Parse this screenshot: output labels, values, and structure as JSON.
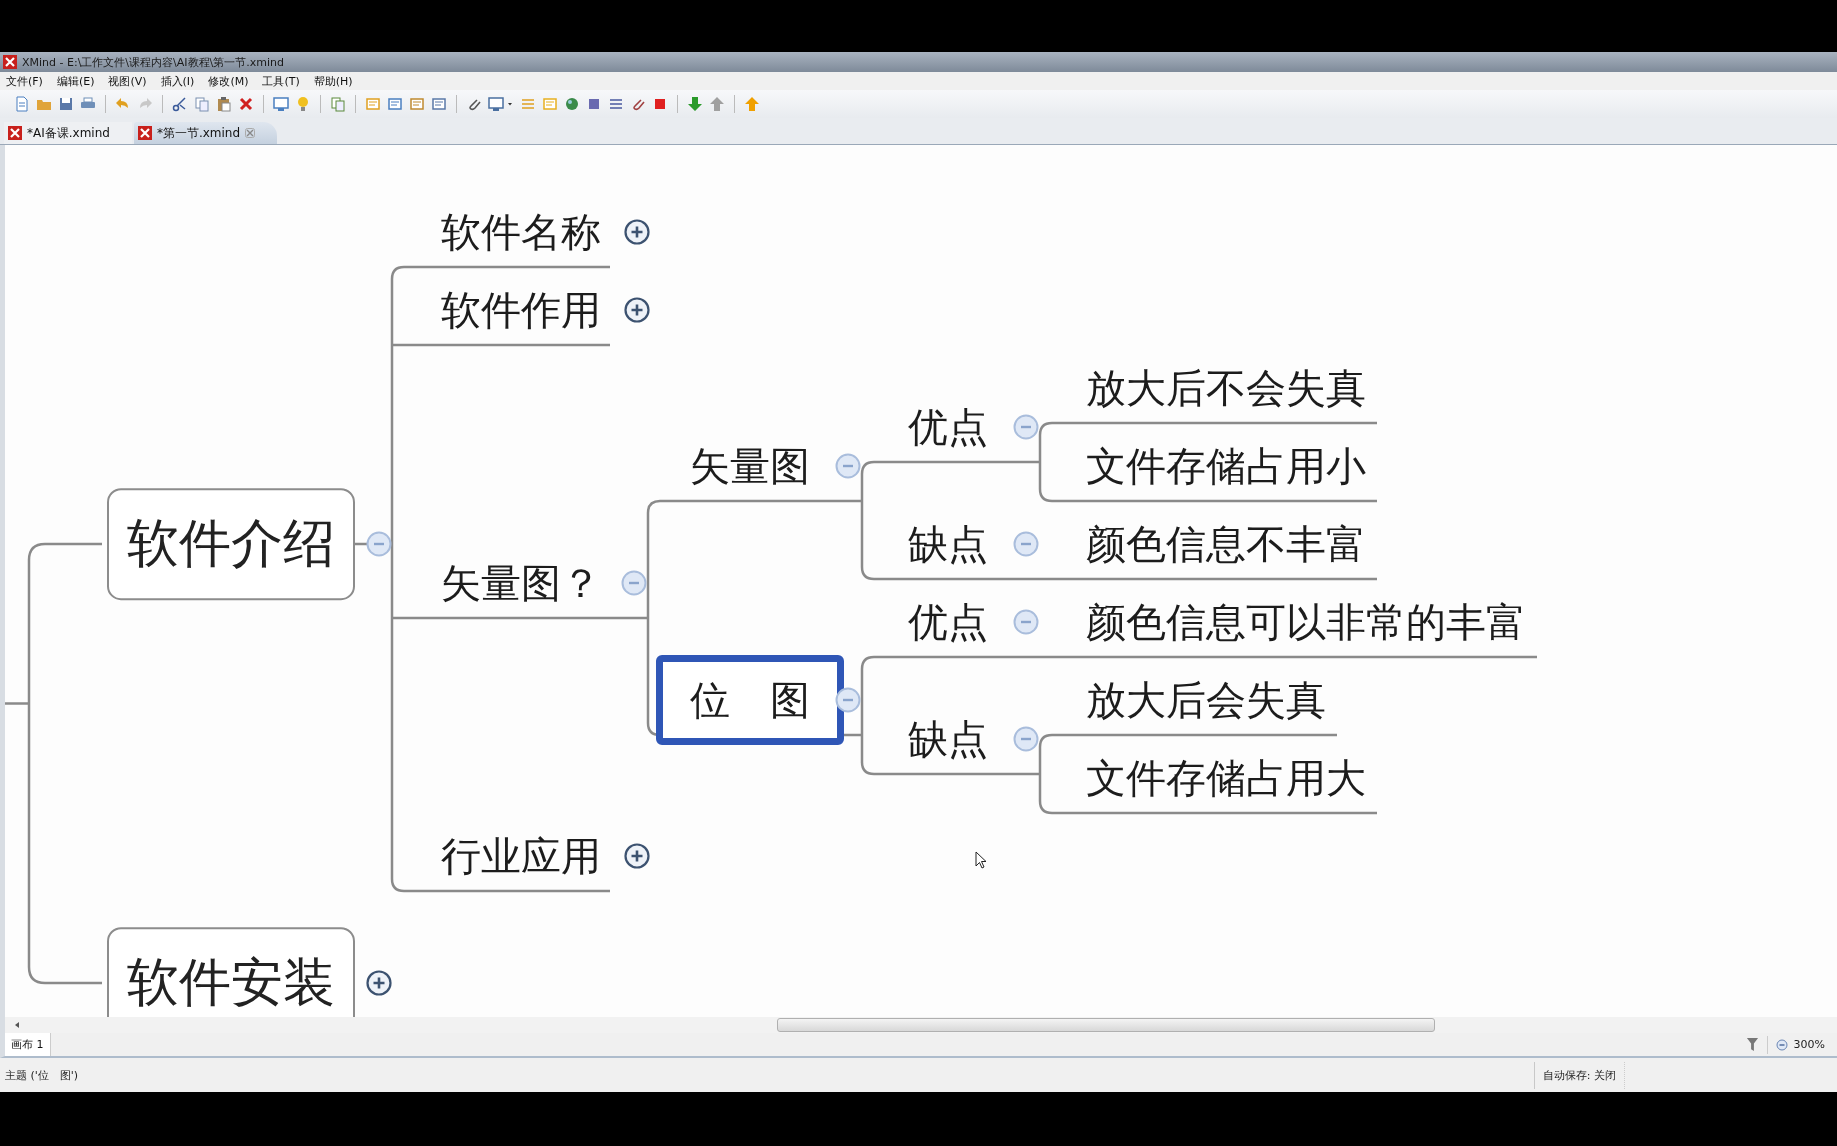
{
  "window": {
    "title": "XMind - E:\\工作文件\\课程内容\\AI教程\\第一节.xmind"
  },
  "menu": [
    "文件(F)",
    "编辑(E)",
    "视图(V)",
    "插入(I)",
    "修改(M)",
    "工具(T)",
    "帮助(H)"
  ],
  "tabs": [
    {
      "label": "*AI备课.xmind",
      "selected": false,
      "closable": false
    },
    {
      "label": "*第一节.xmind",
      "selected": true,
      "closable": true
    }
  ],
  "map": {
    "topics": [
      {
        "label": "软件介绍",
        "kind": "root",
        "selected": false,
        "expanded": true,
        "children": [
          {
            "label": "软件名称",
            "kind": "topic",
            "selected": false,
            "expanded": false
          },
          {
            "label": "软件作用",
            "kind": "topic",
            "selected": false,
            "expanded": false
          },
          {
            "label": "矢量图？",
            "kind": "topic",
            "selected": false,
            "expanded": true,
            "children": [
              {
                "label": "矢量图",
                "kind": "topic",
                "selected": false,
                "expanded": true,
                "children": [
                  {
                    "label": "优点",
                    "kind": "topic",
                    "selected": false,
                    "expanded": true,
                    "children": [
                      {
                        "label": "放大后不会失真",
                        "kind": "topic",
                        "selected": false
                      },
                      {
                        "label": "文件存储占用小",
                        "kind": "topic",
                        "selected": false
                      }
                    ]
                  },
                  {
                    "label": "缺点",
                    "kind": "topic",
                    "selected": false,
                    "expanded": true,
                    "children": [
                      {
                        "label": "颜色信息不丰富",
                        "kind": "topic",
                        "selected": false
                      }
                    ]
                  }
                ]
              },
              {
                "label": "位　图",
                "kind": "topic",
                "selected": true,
                "expanded": true,
                "children": [
                  {
                    "label": "优点",
                    "kind": "topic",
                    "selected": false,
                    "expanded": true,
                    "children": [
                      {
                        "label": "颜色信息可以非常的丰富",
                        "kind": "topic",
                        "selected": false
                      }
                    ]
                  },
                  {
                    "label": "缺点",
                    "kind": "topic",
                    "selected": false,
                    "expanded": true,
                    "children": [
                      {
                        "label": "放大后会失真",
                        "kind": "topic",
                        "selected": false
                      },
                      {
                        "label": "文件存储占用大",
                        "kind": "topic",
                        "selected": false
                      }
                    ]
                  }
                ]
              }
            ]
          },
          {
            "label": "行业应用",
            "kind": "topic",
            "selected": false,
            "expanded": false
          }
        ]
      },
      {
        "label": "软件安装",
        "kind": "root",
        "selected": false,
        "expanded": false
      }
    ]
  },
  "sheet_tabs": [
    {
      "label": "画布 1",
      "selected": true
    }
  ],
  "zoom_level": "300%",
  "status_bar": {
    "selection": "主题 ('位　图')",
    "autosave": "自动保存: 关闭"
  }
}
